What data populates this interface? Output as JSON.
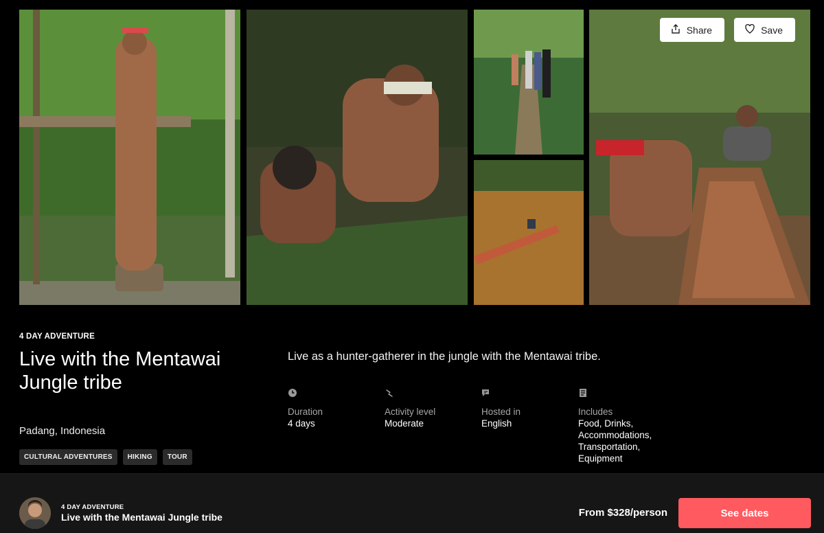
{
  "gallery": {
    "share_label": "Share",
    "save_label": "Save"
  },
  "experience": {
    "eyebrow": "4 DAY ADVENTURE",
    "title": "Live with the Mentawai Jungle tribe",
    "location": "Padang, Indonesia",
    "tags": [
      "CULTURAL ADVENTURES",
      "HIKING",
      "TOUR"
    ],
    "tagline": "Live as a hunter-gatherer in the jungle with the Mentawai tribe."
  },
  "facts": [
    {
      "icon": "clock-icon",
      "label": "Duration",
      "value": "4 days"
    },
    {
      "icon": "activity-icon",
      "label": "Activity level",
      "value": "Moderate"
    },
    {
      "icon": "chat-icon",
      "label": "Hosted in",
      "value": "English"
    },
    {
      "icon": "list-icon",
      "label": "Includes",
      "value": "Food, Drinks, Accommodations, Transportation, Equipment"
    }
  ],
  "bottom_bar": {
    "eyebrow": "4 DAY ADVENTURE",
    "title": "Live with the Mentawai Jungle tribe",
    "price": "From $328/person",
    "cta_label": "See dates"
  },
  "colors": {
    "background": "#000000",
    "bar_background": "#161616",
    "cta": "#ff5a5f",
    "tag_background": "#2b2b2b"
  }
}
